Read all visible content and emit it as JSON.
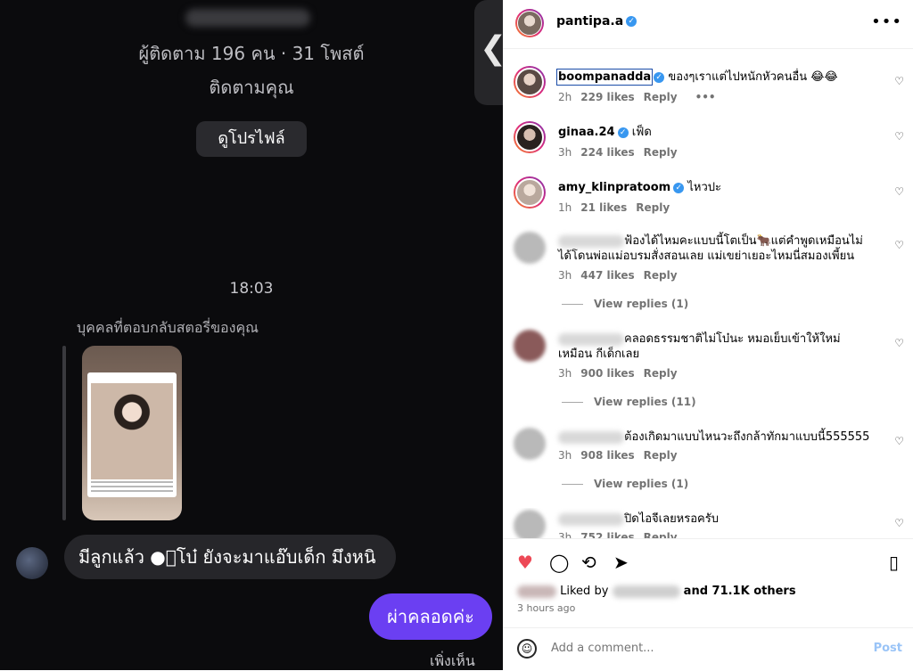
{
  "chat": {
    "followers_line": "ผู้ติดตาม 196 คน · 31 โพสต์",
    "follows_you": "ติดตามคุณ",
    "view_profile": "ดูโปรไฟล์",
    "back_chevron": "❮",
    "time": "18:03",
    "replied_to_story": "บุคคลที่ตอบกลับสตอรี่ของคุณ",
    "incoming_message": "มีลูกแล้ว ●ีโบ๋ ยังจะมาแอ๊บเด็ก มึงหนิ",
    "outgoing_message": "ผ่าคลอดค่ะ",
    "seen": "เพิ่งเห็น"
  },
  "post": {
    "username": "pantipa.a",
    "comments": [
      {
        "user": "boompanadda",
        "text": "ของๆเราแต่ไปหนักหัวคนอื่น 😂😂",
        "time": "2h",
        "likes": "229 likes",
        "reply": "Reply",
        "more": "•••"
      },
      {
        "user": "ginaa.24",
        "text": "เฟ็ด",
        "time": "3h",
        "likes": "224 likes",
        "reply": "Reply"
      },
      {
        "user": "amy_klinpratoom",
        "text": "ไหวปะ",
        "time": "1h",
        "likes": "21 likes",
        "reply": "Reply"
      },
      {
        "text": "ฟ้องได้ไหมคะแบบนี้โตเป็น🐂แต่คำพูดเหมือนไม่ได้โดนพ่อแม่อบรมสั่งสอนเลย แม่เขย่าเยอะไหมนี่สมองเพี้ยน",
        "time": "3h",
        "likes": "447 likes",
        "reply": "Reply",
        "view_replies": "View replies (1)"
      },
      {
        "text": "คลอดธรรมชาติไม่โบ๋นะ หมอเย็บเข้าให้ใหม่ เหมือน กีเด็กเลย",
        "time": "3h",
        "likes": "900 likes",
        "reply": "Reply",
        "view_replies": "View replies (11)"
      },
      {
        "text": "ต้องเกิดมาแบบไหนวะถึงกล้าทักมาแบบนี้555555",
        "time": "3h",
        "likes": "908 likes",
        "reply": "Reply",
        "view_replies": "View replies (1)"
      },
      {
        "text": "ปิดไอจีเลยหรอครับ",
        "time": "3h",
        "likes": "752 likes",
        "reply": "Reply"
      }
    ],
    "liked_by_prefix": "Liked by",
    "liked_by_suffix": "and 71.1K others",
    "posted_ago": "3 hours ago",
    "add_comment_placeholder": "Add a comment...",
    "post_label": "Post",
    "colors": {
      "verified": "#3897f0",
      "heart_liked": "#ed4956",
      "outgoing_bubble": "#6b3ff2"
    }
  }
}
